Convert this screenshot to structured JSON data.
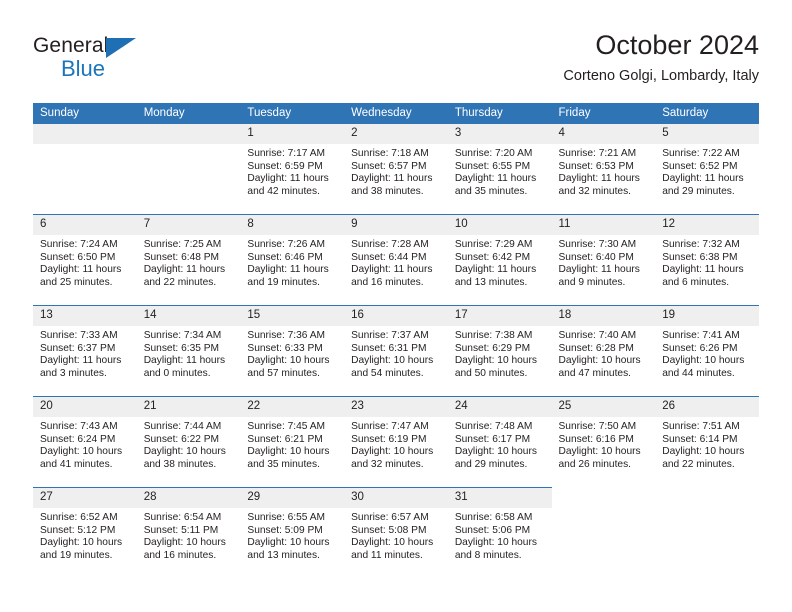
{
  "brand": {
    "name_top": "General",
    "name_bottom": "Blue",
    "triangle_color": "#1f6fb5",
    "blue_color": "#1b75bb"
  },
  "header": {
    "title": "October 2024",
    "subtitle": "Corteno Golgi, Lombardy, Italy"
  },
  "theme": {
    "header_blue": "#2f74b5",
    "daynum_gray": "#efefef",
    "text": "#231f20"
  },
  "weekdays": [
    "Sunday",
    "Monday",
    "Tuesday",
    "Wednesday",
    "Thursday",
    "Friday",
    "Saturday"
  ],
  "weeks": [
    [
      {
        "day": "",
        "blank": true
      },
      {
        "day": "",
        "blank": true
      },
      {
        "day": "1",
        "sunrise": "Sunrise: 7:17 AM",
        "sunset": "Sunset: 6:59 PM",
        "daylight1": "Daylight: 11 hours",
        "daylight2": "and 42 minutes."
      },
      {
        "day": "2",
        "sunrise": "Sunrise: 7:18 AM",
        "sunset": "Sunset: 6:57 PM",
        "daylight1": "Daylight: 11 hours",
        "daylight2": "and 38 minutes."
      },
      {
        "day": "3",
        "sunrise": "Sunrise: 7:20 AM",
        "sunset": "Sunset: 6:55 PM",
        "daylight1": "Daylight: 11 hours",
        "daylight2": "and 35 minutes."
      },
      {
        "day": "4",
        "sunrise": "Sunrise: 7:21 AM",
        "sunset": "Sunset: 6:53 PM",
        "daylight1": "Daylight: 11 hours",
        "daylight2": "and 32 minutes."
      },
      {
        "day": "5",
        "sunrise": "Sunrise: 7:22 AM",
        "sunset": "Sunset: 6:52 PM",
        "daylight1": "Daylight: 11 hours",
        "daylight2": "and 29 minutes."
      }
    ],
    [
      {
        "day": "6",
        "sunrise": "Sunrise: 7:24 AM",
        "sunset": "Sunset: 6:50 PM",
        "daylight1": "Daylight: 11 hours",
        "daylight2": "and 25 minutes."
      },
      {
        "day": "7",
        "sunrise": "Sunrise: 7:25 AM",
        "sunset": "Sunset: 6:48 PM",
        "daylight1": "Daylight: 11 hours",
        "daylight2": "and 22 minutes."
      },
      {
        "day": "8",
        "sunrise": "Sunrise: 7:26 AM",
        "sunset": "Sunset: 6:46 PM",
        "daylight1": "Daylight: 11 hours",
        "daylight2": "and 19 minutes."
      },
      {
        "day": "9",
        "sunrise": "Sunrise: 7:28 AM",
        "sunset": "Sunset: 6:44 PM",
        "daylight1": "Daylight: 11 hours",
        "daylight2": "and 16 minutes."
      },
      {
        "day": "10",
        "sunrise": "Sunrise: 7:29 AM",
        "sunset": "Sunset: 6:42 PM",
        "daylight1": "Daylight: 11 hours",
        "daylight2": "and 13 minutes."
      },
      {
        "day": "11",
        "sunrise": "Sunrise: 7:30 AM",
        "sunset": "Sunset: 6:40 PM",
        "daylight1": "Daylight: 11 hours",
        "daylight2": "and 9 minutes."
      },
      {
        "day": "12",
        "sunrise": "Sunrise: 7:32 AM",
        "sunset": "Sunset: 6:38 PM",
        "daylight1": "Daylight: 11 hours",
        "daylight2": "and 6 minutes."
      }
    ],
    [
      {
        "day": "13",
        "sunrise": "Sunrise: 7:33 AM",
        "sunset": "Sunset: 6:37 PM",
        "daylight1": "Daylight: 11 hours",
        "daylight2": "and 3 minutes."
      },
      {
        "day": "14",
        "sunrise": "Sunrise: 7:34 AM",
        "sunset": "Sunset: 6:35 PM",
        "daylight1": "Daylight: 11 hours",
        "daylight2": "and 0 minutes."
      },
      {
        "day": "15",
        "sunrise": "Sunrise: 7:36 AM",
        "sunset": "Sunset: 6:33 PM",
        "daylight1": "Daylight: 10 hours",
        "daylight2": "and 57 minutes."
      },
      {
        "day": "16",
        "sunrise": "Sunrise: 7:37 AM",
        "sunset": "Sunset: 6:31 PM",
        "daylight1": "Daylight: 10 hours",
        "daylight2": "and 54 minutes."
      },
      {
        "day": "17",
        "sunrise": "Sunrise: 7:38 AM",
        "sunset": "Sunset: 6:29 PM",
        "daylight1": "Daylight: 10 hours",
        "daylight2": "and 50 minutes."
      },
      {
        "day": "18",
        "sunrise": "Sunrise: 7:40 AM",
        "sunset": "Sunset: 6:28 PM",
        "daylight1": "Daylight: 10 hours",
        "daylight2": "and 47 minutes."
      },
      {
        "day": "19",
        "sunrise": "Sunrise: 7:41 AM",
        "sunset": "Sunset: 6:26 PM",
        "daylight1": "Daylight: 10 hours",
        "daylight2": "and 44 minutes."
      }
    ],
    [
      {
        "day": "20",
        "sunrise": "Sunrise: 7:43 AM",
        "sunset": "Sunset: 6:24 PM",
        "daylight1": "Daylight: 10 hours",
        "daylight2": "and 41 minutes."
      },
      {
        "day": "21",
        "sunrise": "Sunrise: 7:44 AM",
        "sunset": "Sunset: 6:22 PM",
        "daylight1": "Daylight: 10 hours",
        "daylight2": "and 38 minutes."
      },
      {
        "day": "22",
        "sunrise": "Sunrise: 7:45 AM",
        "sunset": "Sunset: 6:21 PM",
        "daylight1": "Daylight: 10 hours",
        "daylight2": "and 35 minutes."
      },
      {
        "day": "23",
        "sunrise": "Sunrise: 7:47 AM",
        "sunset": "Sunset: 6:19 PM",
        "daylight1": "Daylight: 10 hours",
        "daylight2": "and 32 minutes."
      },
      {
        "day": "24",
        "sunrise": "Sunrise: 7:48 AM",
        "sunset": "Sunset: 6:17 PM",
        "daylight1": "Daylight: 10 hours",
        "daylight2": "and 29 minutes."
      },
      {
        "day": "25",
        "sunrise": "Sunrise: 7:50 AM",
        "sunset": "Sunset: 6:16 PM",
        "daylight1": "Daylight: 10 hours",
        "daylight2": "and 26 minutes."
      },
      {
        "day": "26",
        "sunrise": "Sunrise: 7:51 AM",
        "sunset": "Sunset: 6:14 PM",
        "daylight1": "Daylight: 10 hours",
        "daylight2": "and 22 minutes."
      }
    ],
    [
      {
        "day": "27",
        "sunrise": "Sunrise: 6:52 AM",
        "sunset": "Sunset: 5:12 PM",
        "daylight1": "Daylight: 10 hours",
        "daylight2": "and 19 minutes."
      },
      {
        "day": "28",
        "sunrise": "Sunrise: 6:54 AM",
        "sunset": "Sunset: 5:11 PM",
        "daylight1": "Daylight: 10 hours",
        "daylight2": "and 16 minutes."
      },
      {
        "day": "29",
        "sunrise": "Sunrise: 6:55 AM",
        "sunset": "Sunset: 5:09 PM",
        "daylight1": "Daylight: 10 hours",
        "daylight2": "and 13 minutes."
      },
      {
        "day": "30",
        "sunrise": "Sunrise: 6:57 AM",
        "sunset": "Sunset: 5:08 PM",
        "daylight1": "Daylight: 10 hours",
        "daylight2": "and 11 minutes."
      },
      {
        "day": "31",
        "sunrise": "Sunrise: 6:58 AM",
        "sunset": "Sunset: 5:06 PM",
        "daylight1": "Daylight: 10 hours",
        "daylight2": "and 8 minutes."
      },
      {
        "day": "",
        "trailing": true
      },
      {
        "day": "",
        "trailing": true
      }
    ]
  ]
}
